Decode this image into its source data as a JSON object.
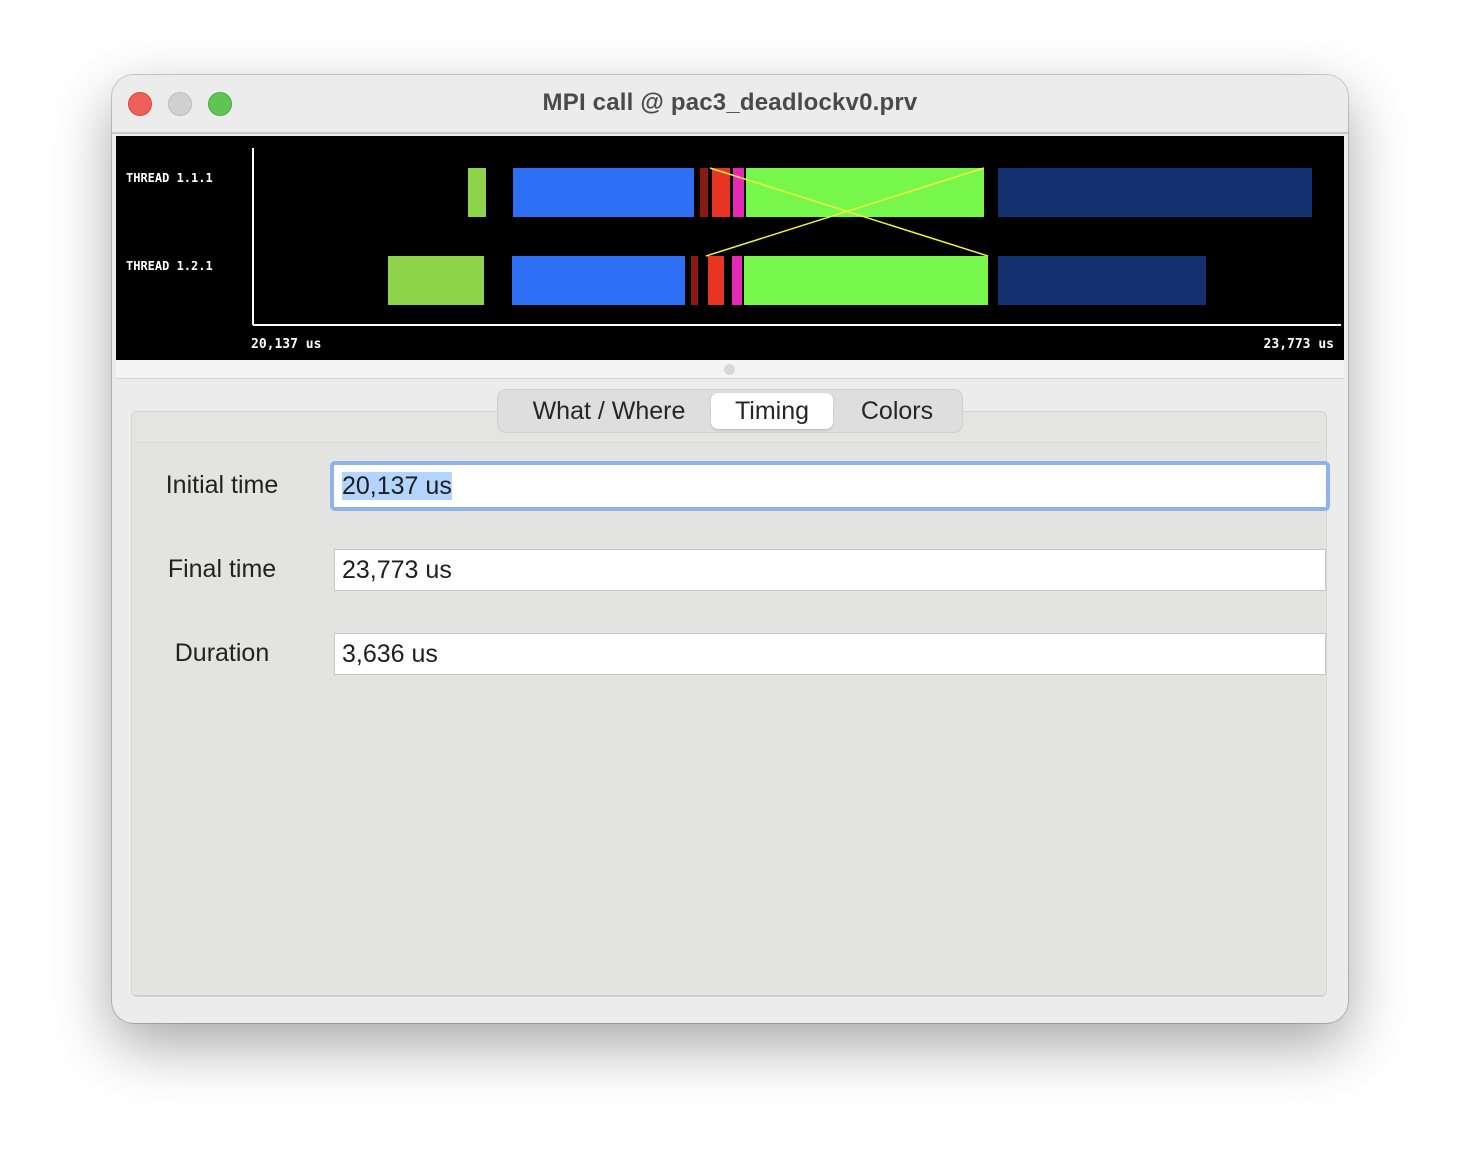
{
  "window": {
    "title": "MPI call @ pac3_deadlockv0.prv"
  },
  "timeline": {
    "rows": [
      {
        "label": "THREAD 1.1.1"
      },
      {
        "label": "THREAD 1.2.1"
      }
    ],
    "start_label": "20,137 us",
    "end_label": "23,773 us",
    "colors": {
      "background": "#000000",
      "axis": "#ffffff",
      "light_green": "#8dd44a",
      "blue": "#2f6ff5",
      "dark_red": "#8b1a12",
      "red": "#e83424",
      "magenta": "#e22ab4",
      "bright_green": "#77f74c",
      "navy": "#14316f",
      "communication_line": "#f2f23a"
    }
  },
  "tabs": [
    {
      "label": "What / Where",
      "selected": false
    },
    {
      "label": "Timing",
      "selected": true
    },
    {
      "label": "Colors",
      "selected": false
    }
  ],
  "timing": {
    "initial_time_label": "Initial time",
    "initial_time_value": "20,137 us",
    "final_time_label": "Final time",
    "final_time_value": "23,773 us",
    "duration_label": "Duration",
    "duration_value": "3,636 us"
  }
}
